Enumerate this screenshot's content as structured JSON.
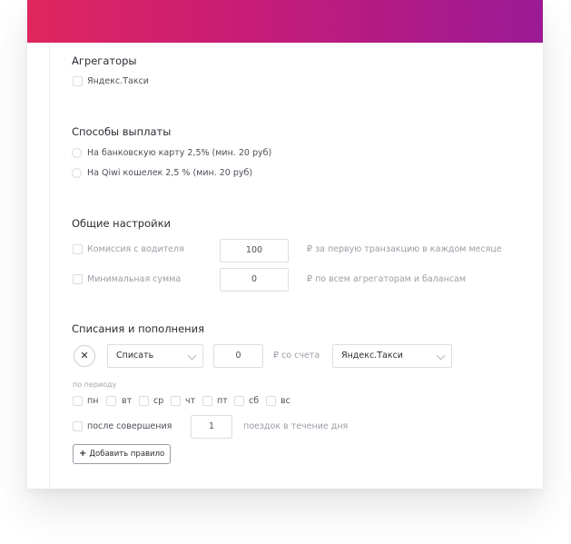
{
  "aggregators": {
    "title": "Агрегаторы",
    "items": [
      {
        "label": "Яндекс.Такси",
        "checked": false
      }
    ]
  },
  "payout": {
    "title": "Способы выплаты",
    "options": [
      {
        "label": "На банковскую карту 2,5% (мин. 20 руб)",
        "selected": false
      },
      {
        "label": "На Qiwi кошелек 2,5 % (мин. 20 руб)",
        "selected": false
      }
    ]
  },
  "general": {
    "title": "Общие настройки",
    "rows": [
      {
        "label": "Комиссия с водителя",
        "value": "100",
        "note": "₽ за первую транзакцию в каждом месяце"
      },
      {
        "label": "Минимальная сумма",
        "value": "0",
        "note": "₽ по всем агрегаторам и балансам"
      }
    ]
  },
  "charges": {
    "title": "Списания и пополнения",
    "remove_icon": "close-icon",
    "action_value": "Списать",
    "amount_value": "0",
    "from_account_label": "₽ со счета",
    "account_value": "Яндекс.Такси",
    "period_label": "по периоду",
    "days": [
      "пн",
      "вт",
      "ср",
      "чт",
      "пт",
      "сб",
      "вс"
    ],
    "after_label": "после совершения",
    "trips_value": "1",
    "trips_label": "поездок в течение дня",
    "add_rule_label": "Добавить правило"
  },
  "colors": {
    "header_start": "#e0265e",
    "header_end": "#9b1a95"
  }
}
